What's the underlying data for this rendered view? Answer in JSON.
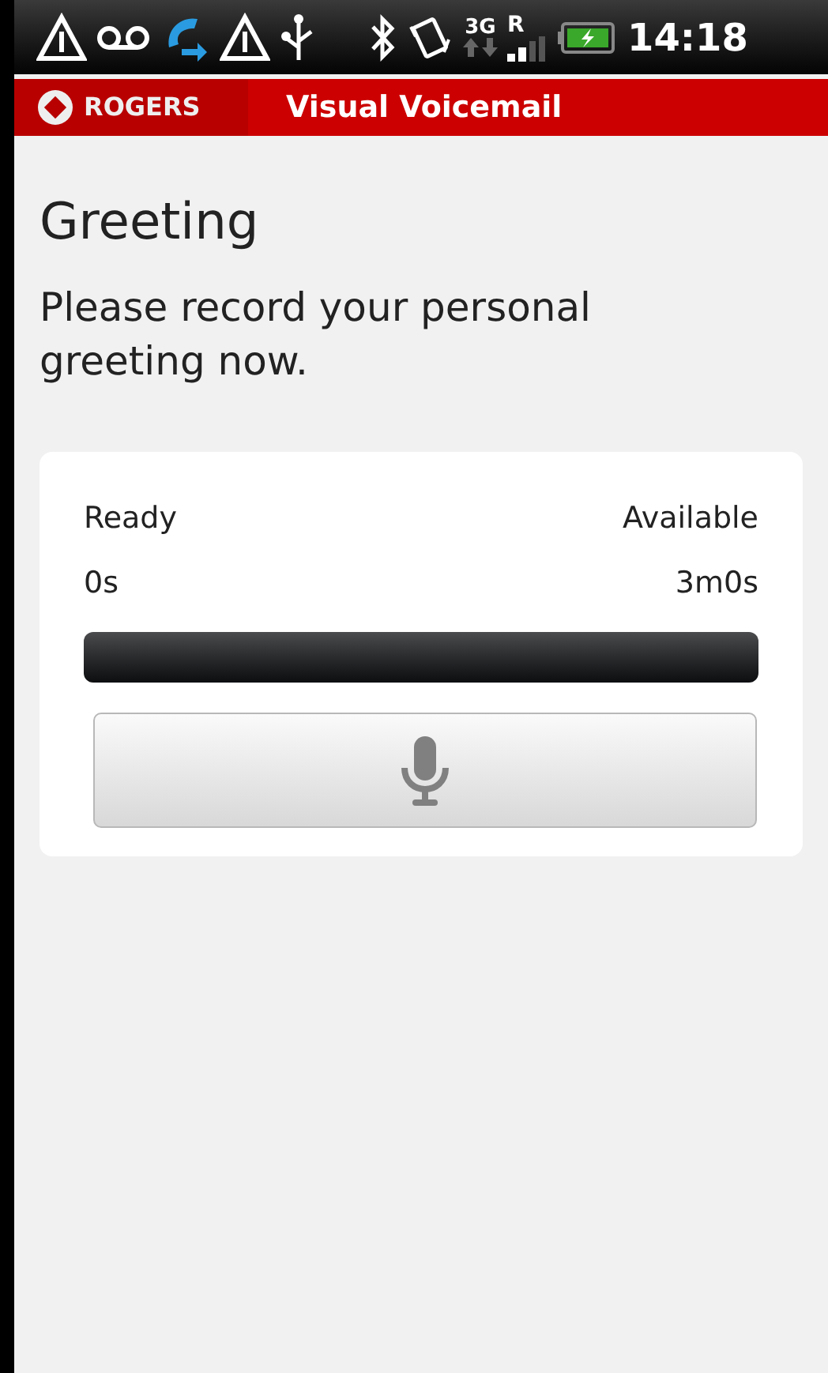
{
  "status_bar": {
    "network": "3G",
    "roaming": "R",
    "time": "14:18"
  },
  "header": {
    "brand": "ROGERS",
    "title": "Visual Voicemail"
  },
  "title": "Greeting",
  "prompt": "Please record your personal greeting now.",
  "recorder": {
    "status": "Ready",
    "status_time": "0s",
    "available_label": "Available",
    "available_time": "3m0s",
    "level": 0
  }
}
